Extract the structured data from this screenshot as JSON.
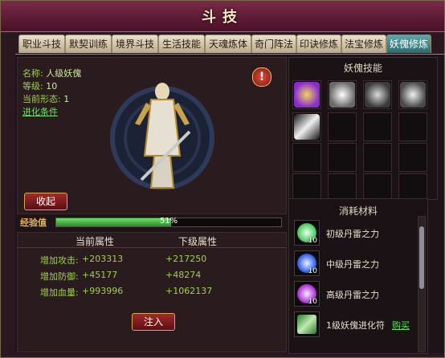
{
  "window": {
    "title": "斗技",
    "close_icon": "close-icon"
  },
  "tabs": [
    {
      "label": "职业斗技",
      "active": false
    },
    {
      "label": "默契训练",
      "active": false
    },
    {
      "label": "境界斗技",
      "active": false
    },
    {
      "label": "生活技能",
      "active": false
    },
    {
      "label": "天魂炼体",
      "active": false
    },
    {
      "label": "奇门阵法",
      "active": false
    },
    {
      "label": "印诀修炼",
      "active": false
    },
    {
      "label": "法宝修炼",
      "active": false
    },
    {
      "label": "妖傀修炼",
      "active": true
    }
  ],
  "puppet": {
    "name_label": "名称:",
    "name": "人级妖傀",
    "level_label": "等级:",
    "level": "10",
    "form_label": "当前形态:",
    "form": "1",
    "advance_link": "进化条件",
    "collapse_button": "收起"
  },
  "skills": {
    "header": "妖傀技能",
    "icons": [
      "purple-orb-skill-icon",
      "warrior-skill-icon",
      "demon-skill-icon",
      "spirit-skill-icon",
      "sword-skill-icon"
    ]
  },
  "materials": {
    "header": "消耗材料",
    "items": [
      {
        "name": "初级丹雷之力",
        "count": "10",
        "color": "#58d16a",
        "buy": ""
      },
      {
        "name": "中级丹雷之力",
        "count": "10",
        "color": "#3d6bf0",
        "buy": ""
      },
      {
        "name": "高级丹雷之力",
        "count": "10",
        "color": "#b23fd9",
        "buy": ""
      },
      {
        "name": "1级妖傀进化符",
        "count": "",
        "color": "#4bbf5a",
        "buy": "购买"
      }
    ]
  },
  "experience": {
    "label": "经验值",
    "percent_text": "51%",
    "fraction": 0.51
  },
  "attributes": {
    "current_header": "当前属性",
    "next_header": "下级属性",
    "rows": [
      {
        "label": "增加攻击:",
        "current": "+203313",
        "next": "+217250"
      },
      {
        "label": "增加防御:",
        "current": "+45177",
        "next": "+48274"
      },
      {
        "label": "增加血量:",
        "current": "+993996",
        "next": "+1062137"
      }
    ],
    "inject_button": "注入"
  }
}
